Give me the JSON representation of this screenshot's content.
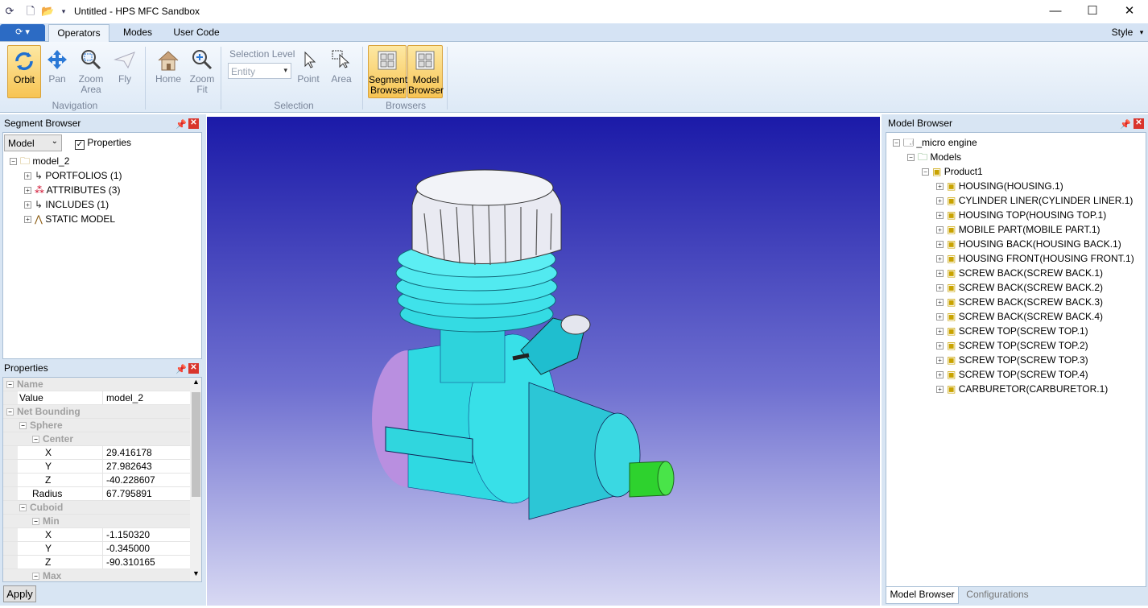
{
  "window": {
    "title": "Untitled - HPS MFC Sandbox",
    "minimize": "—",
    "maximize": "☐",
    "close": "✕"
  },
  "tabs": [
    "Operators",
    "Modes",
    "User Code"
  ],
  "style_menu": "Style",
  "ribbon": {
    "navigation": {
      "label": "Navigation",
      "buttons": [
        "Orbit",
        "Pan",
        "Zoom Area",
        "Fly",
        "Home",
        "Zoom Fit"
      ]
    },
    "selection": {
      "label": "Selection",
      "level_label": "Selection Level",
      "level_value": "Entity",
      "buttons": [
        "Point",
        "Area"
      ]
    },
    "browsers": {
      "label": "Browsers",
      "buttons": [
        "Segment Browser",
        "Model Browser"
      ]
    }
  },
  "segment_browser": {
    "title": "Segment Browser",
    "dropdown_value": "Model",
    "properties_checkbox": "Properties",
    "root": "model_2",
    "items": [
      "PORTFOLIOS (1)",
      "ATTRIBUTES (3)",
      "INCLUDES (1)",
      "STATIC MODEL"
    ]
  },
  "properties": {
    "title": "Properties",
    "rows": [
      {
        "type": "cat",
        "indent": 0,
        "label": "Name"
      },
      {
        "type": "val",
        "indent": 1,
        "label": "Value",
        "value": "model_2"
      },
      {
        "type": "cat",
        "indent": 0,
        "label": "Net Bounding"
      },
      {
        "type": "cat",
        "indent": 1,
        "label": "Sphere"
      },
      {
        "type": "cat",
        "indent": 2,
        "label": "Center"
      },
      {
        "type": "val",
        "indent": 3,
        "label": "X",
        "value": "29.416178"
      },
      {
        "type": "val",
        "indent": 3,
        "label": "Y",
        "value": "27.982643"
      },
      {
        "type": "val",
        "indent": 3,
        "label": "Z",
        "value": "-40.228607"
      },
      {
        "type": "val",
        "indent": 2,
        "label": "Radius",
        "value": "67.795891"
      },
      {
        "type": "cat",
        "indent": 1,
        "label": "Cuboid"
      },
      {
        "type": "cat",
        "indent": 2,
        "label": "Min"
      },
      {
        "type": "val",
        "indent": 3,
        "label": "X",
        "value": "-1.150320"
      },
      {
        "type": "val",
        "indent": 3,
        "label": "Y",
        "value": "-0.345000"
      },
      {
        "type": "val",
        "indent": 3,
        "label": "Z",
        "value": "-90.310165"
      },
      {
        "type": "cat",
        "indent": 2,
        "label": "Max"
      }
    ],
    "apply": "Apply"
  },
  "model_browser": {
    "title": "Model Browser",
    "root": "_micro engine",
    "models": "Models",
    "product": "Product1",
    "parts": [
      "HOUSING(HOUSING.1)",
      "CYLINDER LINER(CYLINDER LINER.1)",
      "HOUSING TOP(HOUSING TOP.1)",
      "MOBILE PART(MOBILE PART.1)",
      "HOUSING BACK(HOUSING BACK.1)",
      "HOUSING FRONT(HOUSING FRONT.1)",
      "SCREW BACK(SCREW BACK.1)",
      "SCREW BACK(SCREW BACK.2)",
      "SCREW BACK(SCREW BACK.3)",
      "SCREW BACK(SCREW BACK.4)",
      "SCREW TOP(SCREW TOP.1)",
      "SCREW TOP(SCREW TOP.2)",
      "SCREW TOP(SCREW TOP.3)",
      "SCREW TOP(SCREW TOP.4)",
      "CARBURETOR(CARBURETOR.1)"
    ],
    "bottom_tabs": [
      "Model Browser",
      "Configurations"
    ]
  }
}
